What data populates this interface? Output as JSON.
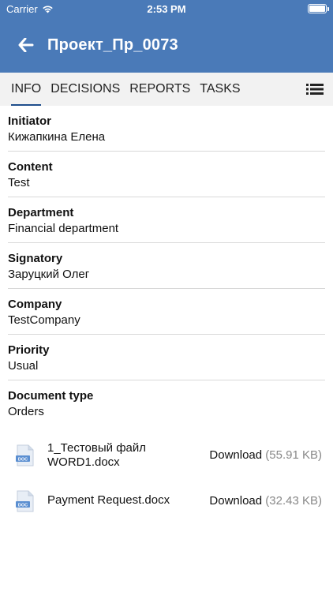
{
  "status_bar": {
    "carrier": "Carrier",
    "time": "2:53 PM"
  },
  "header": {
    "title": "Проект_Пр_0073"
  },
  "tabs": [
    {
      "label": "INFO",
      "active": true
    },
    {
      "label": "DECISIONS",
      "active": false
    },
    {
      "label": "REPORTS",
      "active": false
    },
    {
      "label": "TASKS",
      "active": false
    }
  ],
  "fields": [
    {
      "label": "Initiator",
      "value": "Кижапкина Елена"
    },
    {
      "label": "Content",
      "value": "Test"
    },
    {
      "label": "Department",
      "value": "Financial department"
    },
    {
      "label": "Signatory",
      "value": "Заруцкий Олег"
    },
    {
      "label": "Company",
      "value": "TestCompany"
    },
    {
      "label": "Priority",
      "value": "Usual"
    },
    {
      "label": "Document type",
      "value": "Orders"
    }
  ],
  "attachments": [
    {
      "name_line1": "1_Тестовый файл",
      "name_line2": "WORD1.docx",
      "download_label": "Download",
      "size": "(55.91 KB)",
      "icon_label": "DOC"
    },
    {
      "name_line1": "Payment Request.docx",
      "name_line2": "",
      "download_label": "Download",
      "size": "(32.43 KB)",
      "icon_label": "DOC"
    }
  ],
  "colors": {
    "header": "#4a7ab8",
    "tab_bar": "#f2f2f2",
    "tab_indicator": "#1f4e8c",
    "divider": "#d8d8d8",
    "muted": "#888888"
  }
}
